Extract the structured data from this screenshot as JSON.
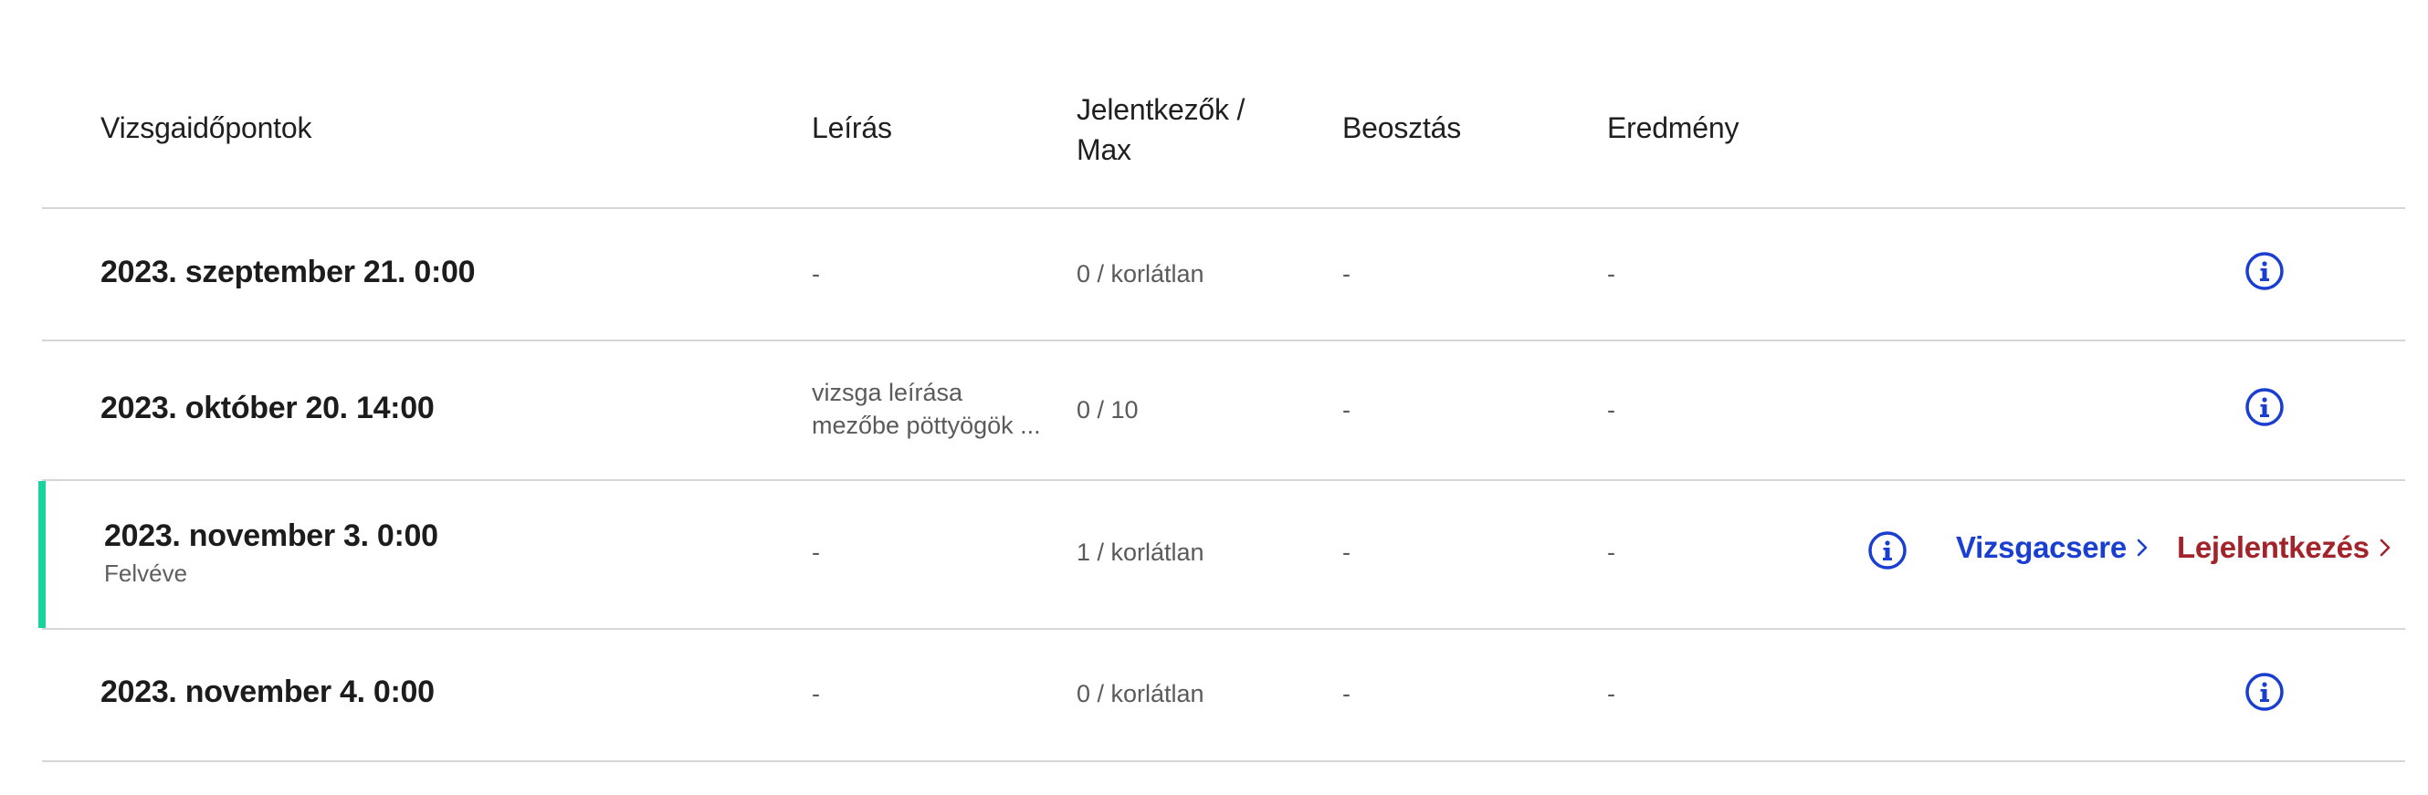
{
  "table": {
    "headers": {
      "slots": "Vizsgaidőpontok",
      "description": "Leírás",
      "applicants_line1": "Jelentkezők /",
      "applicants_line2": "Max",
      "schedule": "Beosztás",
      "result": "Eredmény"
    },
    "rows": [
      {
        "date": "2023. szeptember 21. 0:00",
        "description": "-",
        "applicants": "0 / korlátlan",
        "schedule": "-",
        "result": "-"
      },
      {
        "date": "2023. október 20. 14:00",
        "description": "vizsga leírása mezőbe pöttyögök ...",
        "applicants": "0 / 10",
        "schedule": "-",
        "result": "-"
      },
      {
        "date": "2023. november 3. 0:00",
        "status": "Felvéve",
        "description": "-",
        "applicants": "1 / korlátlan",
        "schedule": "-",
        "result": "-",
        "actions": {
          "swap_label": "Vizsgacsere",
          "unregister_label": "Lejelentkezés"
        }
      },
      {
        "date": "2023. november 4. 0:00",
        "description": "-",
        "applicants": "0 / korlátlan",
        "schedule": "-",
        "result": "-"
      }
    ]
  },
  "icons": {
    "info": "info-circle-icon",
    "chevron": "chevron-right-icon"
  },
  "colors": {
    "selected_accent": "#19d39f",
    "link_blue": "#1a3fd0",
    "link_red": "#a3232a",
    "divider": "#d6d6d6"
  }
}
